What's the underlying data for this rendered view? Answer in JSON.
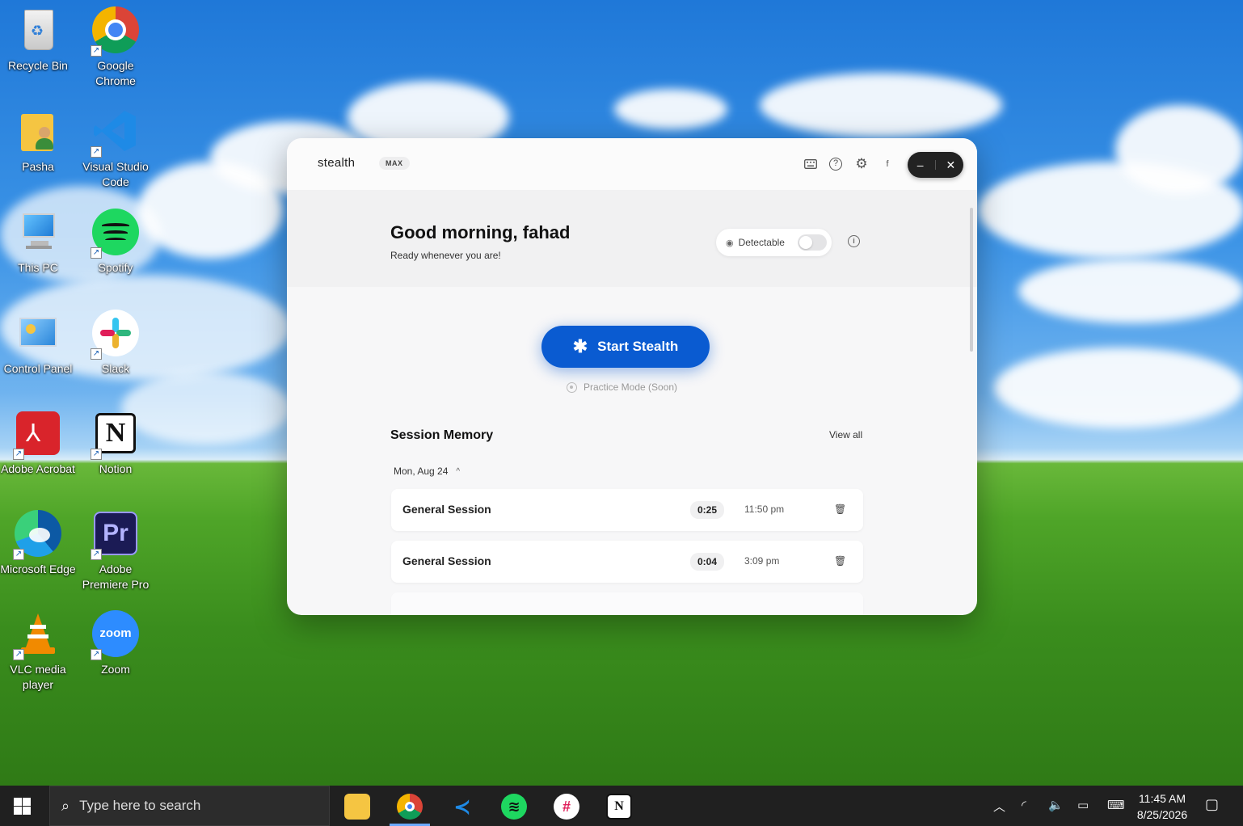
{
  "desktop": {
    "icons": [
      {
        "label": "Recycle Bin",
        "icon": "recycle-bin-icon"
      },
      {
        "label": "Google Chrome",
        "icon": "chrome-icon"
      },
      {
        "label": "Pasha",
        "icon": "user-folder-icon"
      },
      {
        "label": "Visual Studio Code",
        "icon": "vscode-icon"
      },
      {
        "label": "This PC",
        "icon": "computer-icon"
      },
      {
        "label": "Spotify",
        "icon": "spotify-icon"
      },
      {
        "label": "Control Panel",
        "icon": "control-panel-icon"
      },
      {
        "label": "Slack",
        "icon": "slack-icon"
      },
      {
        "label": "Adobe Acrobat",
        "icon": "acrobat-icon"
      },
      {
        "label": "Notion",
        "icon": "notion-icon"
      },
      {
        "label": "Microsoft Edge",
        "icon": "edge-icon"
      },
      {
        "label": "Adobe Premiere Pro",
        "icon": "premiere-icon"
      },
      {
        "label": "VLC media player",
        "icon": "vlc-icon"
      },
      {
        "label": "Zoom",
        "icon": "zoom-icon"
      }
    ]
  },
  "app": {
    "brand": "stealth",
    "plan_badge": "MAX",
    "avatar_letter": "f",
    "greeting": "Good morning, fahad",
    "subtitle": "Ready whenever you are!",
    "detectable_label": "Detectable",
    "detectable_on": false,
    "start_button": "Start Stealth",
    "practice_mode": "Practice Mode (Soon)",
    "session_memory_title": "Session Memory",
    "view_all": "View all",
    "date_group": "Mon, Aug 24",
    "sessions": [
      {
        "name": "General Session",
        "duration": "0:25",
        "time": "11:50 pm"
      },
      {
        "name": "General Session",
        "duration": "0:04",
        "time": "3:09 pm"
      }
    ],
    "colors": {
      "accent": "#0a5bd1"
    }
  },
  "taskbar": {
    "search_placeholder": "Type here to search",
    "pinned": [
      "file-explorer-icon",
      "chrome-icon",
      "vscode-icon",
      "spotify-icon",
      "slack-icon",
      "notion-icon"
    ],
    "clock_time": "11:45 AM",
    "clock_date": "8/25/2026"
  }
}
